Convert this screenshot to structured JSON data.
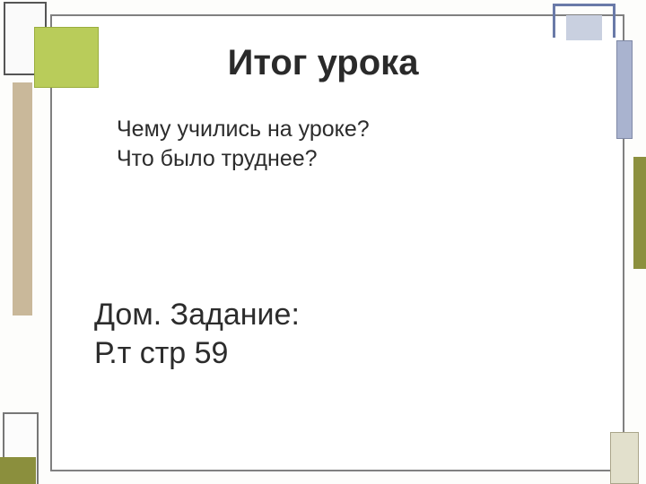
{
  "title": "Итог урока",
  "questions": {
    "line1": "Чему учились на уроке?",
    "line2": "Что было труднее?"
  },
  "homework": {
    "line1": "Дом. Задание:",
    "line2": "Р.т стр 59"
  }
}
